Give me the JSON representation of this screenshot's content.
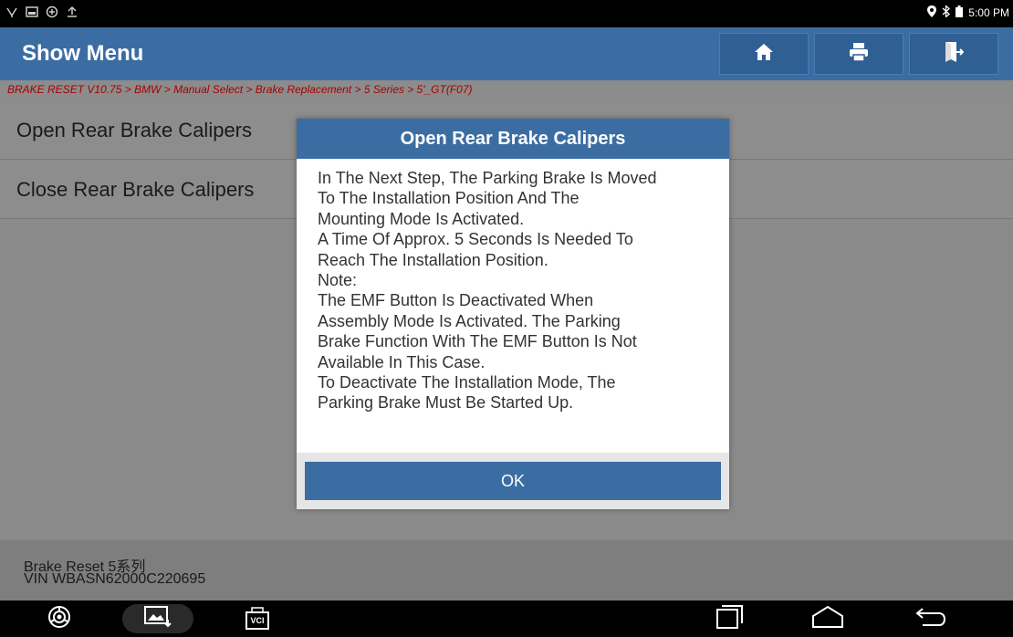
{
  "status_bar": {
    "time": "5:00 PM",
    "icons": [
      "usb-icon",
      "screenshot-icon",
      "settings-sync-icon",
      "upload-icon",
      "location-icon",
      "bluetooth-icon",
      "battery-icon"
    ]
  },
  "header": {
    "title": "Show Menu",
    "buttons": [
      "home-icon",
      "print-icon",
      "exit-icon"
    ]
  },
  "breadcrumb": "BRAKE RESET V10.75 > BMW > Manual Select > Brake Replacement > 5 Series > 5'_GT(F07)",
  "menu": {
    "items": [
      {
        "label": "Open Rear Brake Calipers"
      },
      {
        "label": "Close Rear Brake Calipers"
      }
    ]
  },
  "dialog": {
    "title": "Open Rear Brake Calipers",
    "lines": [
      "In The Next Step, The Parking Brake Is Moved",
      "To The Installation Position And The",
      "Mounting Mode Is Activated.",
      "A Time Of Approx. 5 Seconds Is Needed To",
      "Reach The Installation Position.",
      "Note:",
      "The EMF Button Is Deactivated When",
      "Assembly Mode Is Activated. The Parking",
      "Brake Function With The EMF Button Is Not",
      "Available In This Case.",
      "To Deactivate The Installation Mode, The",
      "Parking Brake Must Be Started Up."
    ],
    "ok_label": "OK"
  },
  "footer": {
    "line1": "Brake Reset 5系列",
    "line2": "VIN WBASN62000C220695"
  },
  "nav": {
    "vci_label": "VCI",
    "icons": [
      "browser-icon",
      "gallery-icon",
      "vci-icon",
      "recent-apps-icon",
      "home-nav-icon",
      "back-icon"
    ]
  },
  "colors": {
    "accent": "#3b6da3",
    "breadcrumb": "#a80000"
  }
}
